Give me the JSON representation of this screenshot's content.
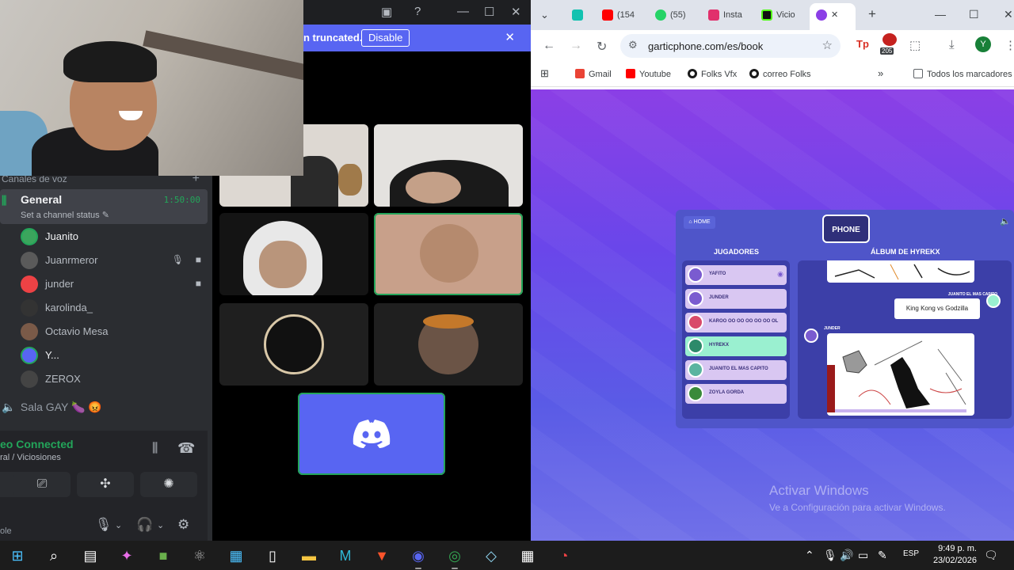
{
  "discord": {
    "banner": {
      "text": "n truncated.",
      "button": "Disable"
    },
    "voice_header": "Canales de voz",
    "channel": {
      "name": "General",
      "timer": "1:50:00",
      "status": "Set a channel status"
    },
    "members": [
      {
        "name": "Juanito",
        "color": "#3ba55d",
        "speaking": true
      },
      {
        "name": "Juanrmeror",
        "color": "#5a5a5a",
        "speaking": false
      },
      {
        "name": "junder",
        "color": "#ed4245",
        "speaking": false
      },
      {
        "name": "karolinda_",
        "color": "#333333",
        "speaking": false
      },
      {
        "name": "Octavio Mesa",
        "color": "#7a5a48",
        "speaking": false
      },
      {
        "name": "Y...",
        "color": "#5865f2",
        "speaking": true
      },
      {
        "name": "ZEROX",
        "color": "#444444",
        "speaking": false
      }
    ],
    "other_channel": "Sala GAY 🍆 😡",
    "voice_status": {
      "title": "eo Connected",
      "subtitle": "ral / Viciosiones"
    },
    "userbar_label": "ole"
  },
  "chrome": {
    "tabs": [
      {
        "label": "",
        "color": "#12c2b0"
      },
      {
        "label": "(154",
        "color": "#ff0000"
      },
      {
        "label": "(55)",
        "color": "#25d366"
      },
      {
        "label": "Insta",
        "color": "#e1306c"
      },
      {
        "label": "Vicio",
        "color": "#111111"
      }
    ],
    "url": "garticphone.com/es/book",
    "ext_badge": "205",
    "profile_initial": "Y",
    "bookmarks": [
      {
        "label": "Gmail",
        "color": "#ea4335"
      },
      {
        "label": "Youtube",
        "color": "#ff0000"
      },
      {
        "label": "Folks Vfx",
        "color": "#1a1a1a"
      },
      {
        "label": "correo Folks",
        "color": "#1a1a1a"
      }
    ],
    "bookmarks_all": "Todos los marcadores"
  },
  "gartic": {
    "home": "HOME",
    "logo": "PHONE",
    "players_title": "JUGADORES",
    "album_title": "ÁLBUM DE HYREKX",
    "players": [
      {
        "name": "YAFITO",
        "me": false
      },
      {
        "name": "JUNDER",
        "me": false
      },
      {
        "name": "KAROO OO OO OO OO OO OL",
        "me": false
      },
      {
        "name": "HYREKX",
        "me": true
      },
      {
        "name": "JUANITO EL MAS CAPITO",
        "me": false
      },
      {
        "name": "ZOYLA GORDA",
        "me": false
      }
    ],
    "guesser": "JUANITO EL MAS CAPITO",
    "guess": "King Kong vs Godzilla",
    "drawer": "JUNDER"
  },
  "watermark": {
    "title": "Activar Windows",
    "subtitle": "Ve a Configuración para activar Windows."
  },
  "taskbar": {
    "lang": "ESP",
    "time": "9:49 p. m.",
    "date": "23/02/2026"
  }
}
